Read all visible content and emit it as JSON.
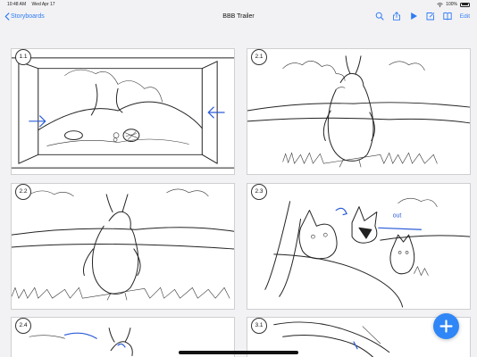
{
  "status_bar": {
    "time": "10:48 AM",
    "date": "Wed Apr 17",
    "battery": "100%"
  },
  "nav": {
    "back_label": "Storyboards",
    "title": "BBB Trailer",
    "edit_label": "Edit",
    "accent_color": "#2f7bf6"
  },
  "panels": [
    {
      "label": "1.1"
    },
    {
      "label": "2.1"
    },
    {
      "label": "2.2"
    },
    {
      "label": "2.3"
    },
    {
      "label": "2.4"
    },
    {
      "label": "3.1"
    }
  ],
  "icons": {
    "back": "chevron-left-icon",
    "search": "search-icon",
    "share": "share-icon",
    "play": "play-icon",
    "compose": "compose-icon",
    "book": "book-icon",
    "add": "plus-icon"
  },
  "sketch_annotations": {
    "panel_2_3_note": "out"
  }
}
